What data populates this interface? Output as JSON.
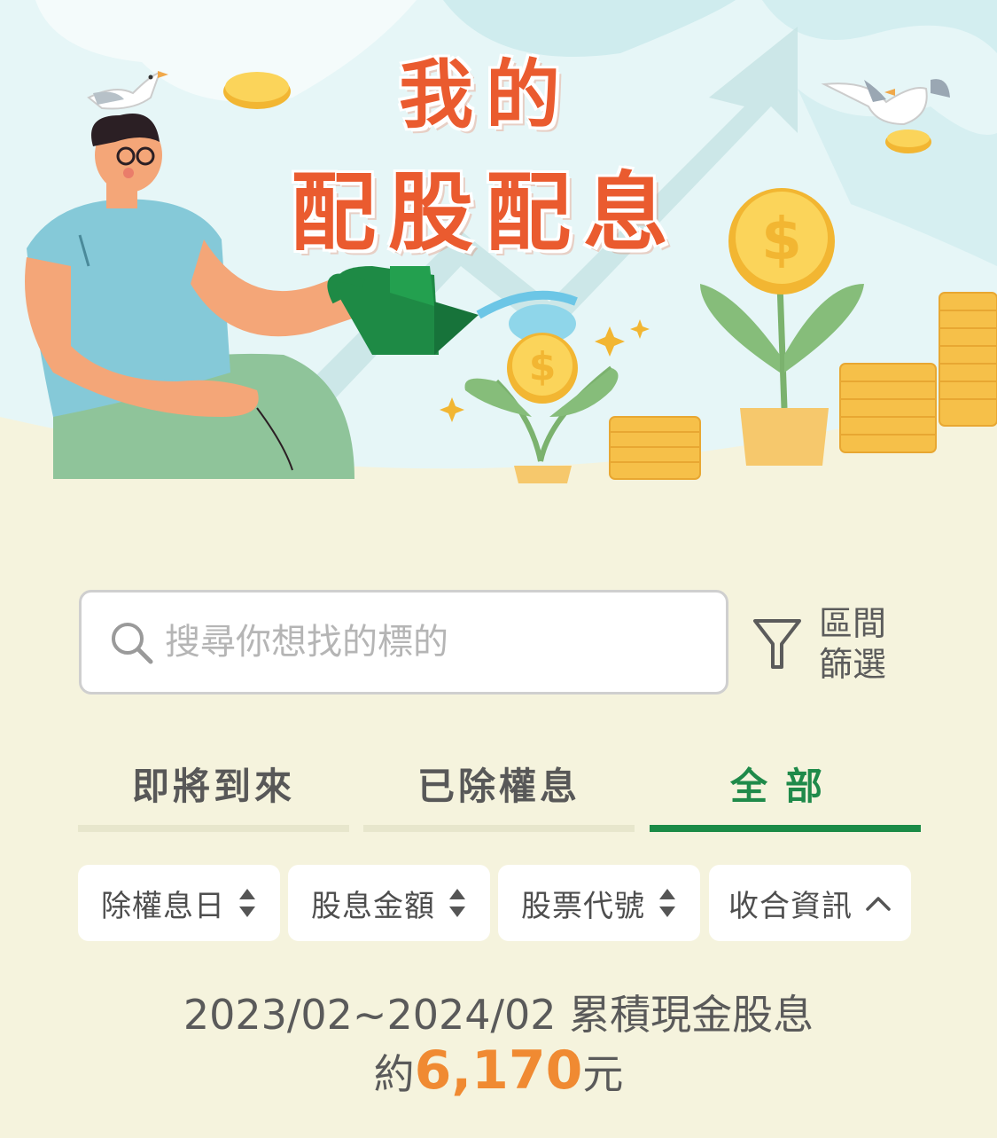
{
  "hero": {
    "title_line1": "我的",
    "title_line2": "配股配息"
  },
  "search": {
    "placeholder": "搜尋你想找的標的"
  },
  "filter": {
    "label": "區間\n篩選"
  },
  "tabs": [
    {
      "label": "即將到來",
      "active": false
    },
    {
      "label": "已除權息",
      "active": false
    },
    {
      "label": "全部",
      "active": true
    }
  ],
  "sort_buttons": [
    {
      "label": "除權息日",
      "icon": "sort-updown-icon"
    },
    {
      "label": "股息金額",
      "icon": "sort-updown-icon"
    },
    {
      "label": "股票代號",
      "icon": "sort-updown-icon"
    },
    {
      "label": "收合資訊",
      "icon": "chevron-up-icon"
    }
  ],
  "summary": {
    "range": "2023/02~2024/02 累積現金股息",
    "prefix": "約",
    "amount": "6,170",
    "suffix": "元"
  },
  "colors": {
    "accent_green": "#1a8a46",
    "amount_orange": "#f08a32",
    "title_red": "#ea5b2f",
    "background": "#f5f3dd"
  }
}
